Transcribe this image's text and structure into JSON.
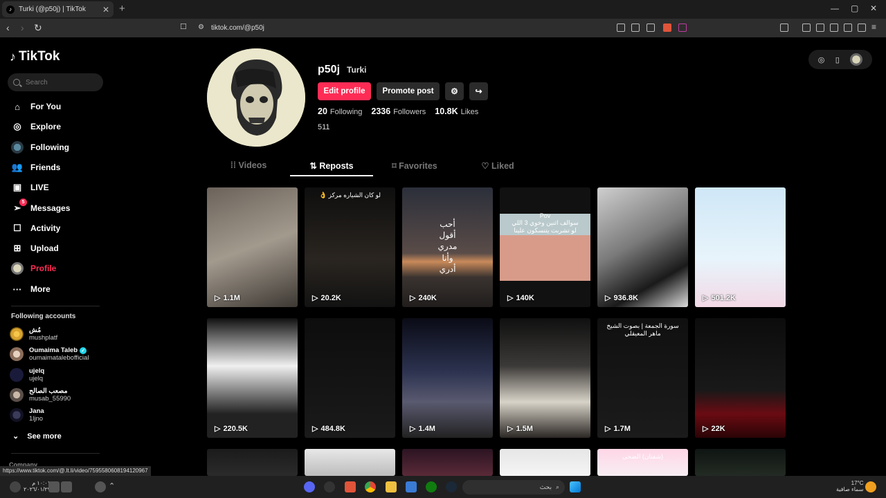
{
  "browser": {
    "tab_title": "Turki (@p50j) | TikTok",
    "url": "tiktok.com/@p50j",
    "status_url": "https://www.tiktok.com/@.lt.li/video/7595580608194120967"
  },
  "sidebar": {
    "logo": "TikTok",
    "search_placeholder": "Search",
    "nav": [
      {
        "label": "For You",
        "icon": "home-icon"
      },
      {
        "label": "Explore",
        "icon": "compass-icon"
      },
      {
        "label": "Following",
        "icon": "following-avatar"
      },
      {
        "label": "Friends",
        "icon": "friends-icon"
      },
      {
        "label": "LIVE",
        "icon": "live-icon"
      },
      {
        "label": "Messages",
        "icon": "paper-plane-icon",
        "badge": "5"
      },
      {
        "label": "Activity",
        "icon": "activity-icon"
      },
      {
        "label": "Upload",
        "icon": "plus-square-icon"
      },
      {
        "label": "Profile",
        "icon": "profile-avatar"
      },
      {
        "label": "More",
        "icon": "more-icon"
      }
    ],
    "following_title": "Following accounts",
    "accounts": [
      {
        "name": "مُش",
        "handle": "mushplatf",
        "verified": false,
        "color": "#d8a330"
      },
      {
        "name": "Oumaima Taleb",
        "handle": "oumaimataleb​official",
        "verified": true,
        "color": "#b9a08a"
      },
      {
        "name": "ujelq",
        "handle": "ujelq",
        "verified": false,
        "color": "#1a1a3a"
      },
      {
        "name": "مصعب الصالح",
        "handle": "musab_55990",
        "verified": false,
        "color": "#8a7a70"
      },
      {
        "name": "Jana",
        "handle": "1ljno",
        "verified": false,
        "color": "#111122"
      }
    ],
    "see_more": "See more",
    "company": "Company"
  },
  "profile": {
    "username": "p50j",
    "nickname": "Turki",
    "edit_label": "Edit profile",
    "promote_label": "Promote post",
    "following_count": "20",
    "following_label": "Following",
    "followers_count": "2336",
    "followers_label": "Followers",
    "likes_count": "10.8K",
    "likes_label": "Likes",
    "bio": "511"
  },
  "tabs": [
    "Videos",
    "Reposts",
    "Favorites",
    "Liked"
  ],
  "active_tab": "Reposts",
  "videos": [
    {
      "views": "1.1M",
      "bg": "linear-gradient(160deg,#6b625a,#a39a8e 50%,#3d3833)"
    },
    {
      "views": "20.2K",
      "bg": "linear-gradient(180deg,#0e0e0e,#2a2520 60%,#121212)",
      "overlay": "لو كان الشياره مركز 👌"
    },
    {
      "views": "240K",
      "bg": "linear-gradient(180deg,#2b2f3a,#5a4c48 55%,#c98a5a 62%,#3a3330 75%,#201d1c)",
      "overlay": "أحب\nأقول\nمدري\nوأنا\nأدري"
    },
    {
      "views": "140K",
      "bg": "linear-gradient(180deg,#111 0 22%,#b9c9cc 22% 40%,#d89b8a 40% 78%,#111 78%)",
      "overlay": "Pov\nسوالف اثنين وخوي 3 اللي\nلو تشربت يتنسكون علينا"
    },
    {
      "views": "936.8K",
      "bg": "linear-gradient(150deg,#cfcfcf,#7a7a7a 45%,#1a1a1a 75%,#dcdcdc)"
    },
    {
      "views": "501.2K",
      "bg": "linear-gradient(180deg,#cfe7f7,#e8f4fb 60%,#f2d9e6)"
    },
    {
      "views": "220.5K",
      "bg": "linear-gradient(180deg,#111,#f0f0f0 40%,#222 80%)"
    },
    {
      "views": "484.8K",
      "bg": "linear-gradient(180deg,#0d0d0d,#1a1a1a)"
    },
    {
      "views": "1.4M",
      "bg": "linear-gradient(180deg,#0a0b16,#2d3350 45%,#5a5a70 70%,#222)"
    },
    {
      "views": "1.5M",
      "bg": "linear-gradient(180deg,#101010,#3c3a38 40%,#d8d3c8 70%,#2b2724)"
    },
    {
      "views": "1.7M",
      "bg": "linear-gradient(180deg,#101010,#1b1b1b)",
      "overlay": "سورة الجمعة | بصوت الشيخ ماهر المعيقلي"
    },
    {
      "views": "22K",
      "bg": "linear-gradient(180deg,#0c0c0c,#191919 60%,#6a0b12 80%,#2a0406)"
    },
    {
      "views": "",
      "bg": "linear-gradient(180deg,#1b1b1b,#2b2b2b)"
    },
    {
      "views": "",
      "bg": "linear-gradient(180deg,#e8e8e8,#bcbcbc)"
    },
    {
      "views": "",
      "bg": "linear-gradient(180deg,#2c1422,#5a2a38)"
    },
    {
      "views": "",
      "bg": "linear-gradient(180deg,#e6e6e6,#f5f5f5)"
    },
    {
      "views": "",
      "bg": "linear-gradient(180deg,#ffd6e6,#f7eef2)",
      "overlay": "(شفتان) الضحى"
    },
    {
      "views": "",
      "bg": "linear-gradient(180deg,#0f1512,#232b24)"
    }
  ],
  "taskbar": {
    "search_label": "بحث",
    "weather": "17°C",
    "weather_desc": "سماء صافية",
    "time": "١٠:٠١ م",
    "date": "٢٠٢٦/٠١/٢٩"
  }
}
